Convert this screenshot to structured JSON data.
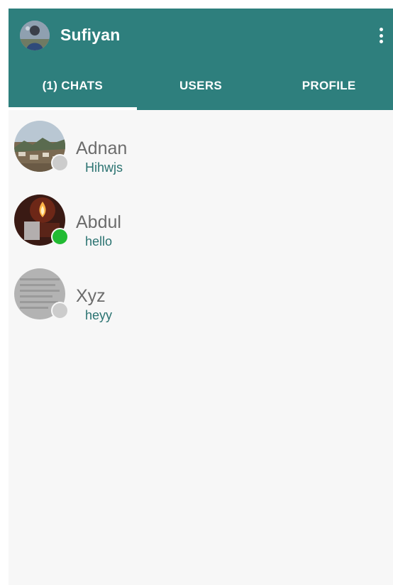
{
  "header": {
    "title": "Sufiyan",
    "menu_icon": "more-vertical-icon",
    "background_color": "#2e7f7d"
  },
  "tabs": [
    {
      "label": "(1) CHATS",
      "selected": true
    },
    {
      "label": "USERS",
      "selected": false
    },
    {
      "label": "PROFILE",
      "selected": false
    }
  ],
  "chats": [
    {
      "name": "Adnan",
      "last_message": "Hihwjs",
      "online": false
    },
    {
      "name": "Abdul",
      "last_message": "hello",
      "online": true
    },
    {
      "name": "Xyz",
      "last_message": "heyy",
      "online": false
    }
  ],
  "colors": {
    "online": "#22bb33",
    "offline": "#cccccc",
    "message": "#2b7371",
    "name": "#6c6c6c"
  }
}
